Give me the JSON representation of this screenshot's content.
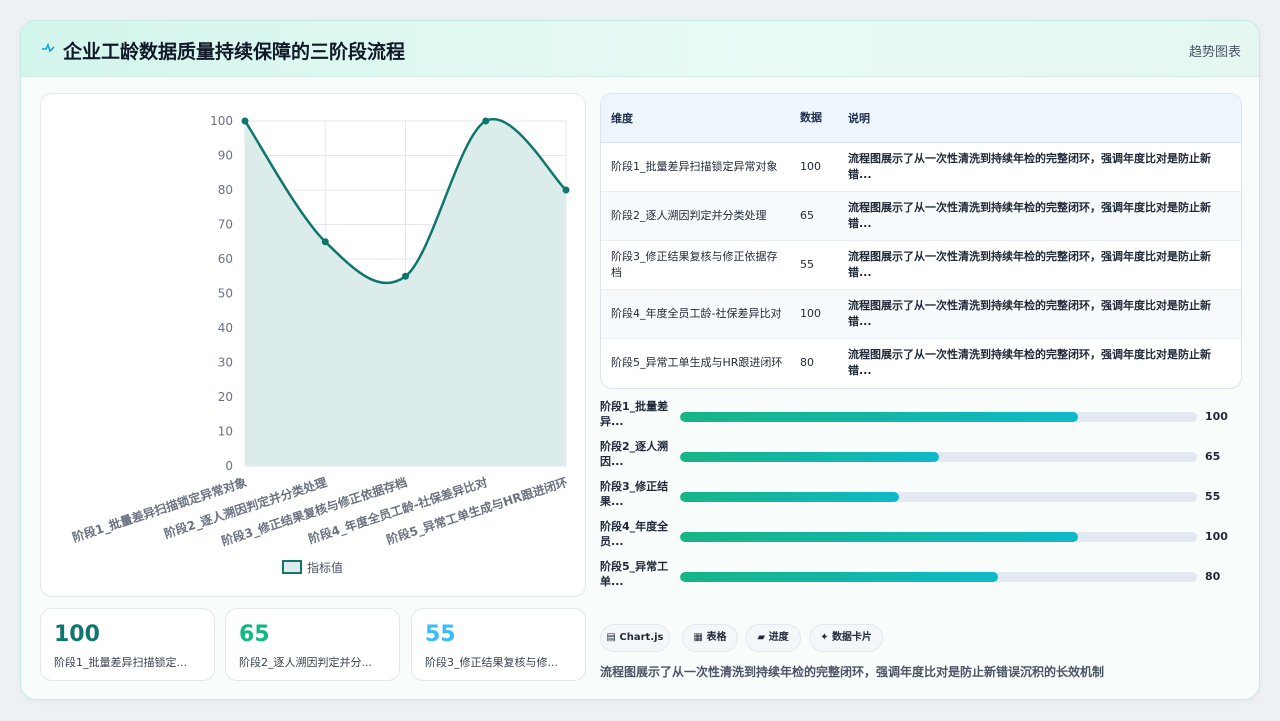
{
  "header": {
    "title": "企业工龄数据质量持续保障的三阶段流程",
    "title_icon": "pulse-icon",
    "link_label": "趋势图表"
  },
  "chart_data": {
    "type": "line",
    "categories": [
      "阶段1_批量差异扫描锁定异常对象",
      "阶段2_逐人溯因判定并分类处理",
      "阶段3_修正结果复核与修正依据存档",
      "阶段4_年度全员工龄-社保差异比对",
      "阶段5_异常工单生成与HR跟进闭环"
    ],
    "series": [
      {
        "name": "指标值",
        "values": [
          100,
          65,
          55,
          100,
          80
        ]
      }
    ],
    "ylim": [
      0,
      100
    ],
    "yticks": [
      0,
      10,
      20,
      30,
      40,
      50,
      60,
      70,
      80,
      90,
      100
    ],
    "fill": true,
    "grid": true,
    "legend_position": "bottom",
    "colors": {
      "line": "#0f766e",
      "fill": "#dcecea",
      "grid": "#e5e7eb"
    }
  },
  "stats": [
    {
      "value": "100",
      "label": "阶段1_批量差异扫描锁定...",
      "color": "#0f766e"
    },
    {
      "value": "65",
      "label": "阶段2_逐人溯因判定并分...",
      "color": "#10b981"
    },
    {
      "value": "55",
      "label": "阶段3_修正结果复核与修...",
      "color": "#38bdf8"
    }
  ],
  "table": {
    "headers": [
      "维度",
      "数据",
      "说明"
    ],
    "rows": [
      {
        "dim": "阶段1_批量差异扫描锁定异常对象",
        "value": "100",
        "desc": "流程图展示了从一次性清洗到持续年检的完整闭环，强调年度比对是防止新错..."
      },
      {
        "dim": "阶段2_逐人溯因判定并分类处理",
        "value": "65",
        "desc": "流程图展示了从一次性清洗到持续年检的完整闭环，强调年度比对是防止新错..."
      },
      {
        "dim": "阶段3_修正结果复核与修正依据存档",
        "value": "55",
        "desc": "流程图展示了从一次性清洗到持续年检的完整闭环，强调年度比对是防止新错..."
      },
      {
        "dim": "阶段4_年度全员工龄-社保差异比对",
        "value": "100",
        "desc": "流程图展示了从一次性清洗到持续年检的完整闭环，强调年度比对是防止新错..."
      },
      {
        "dim": "阶段5_异常工单生成与HR跟进闭环",
        "value": "80",
        "desc": "流程图展示了从一次性清洗到持续年检的完整闭环，强调年度比对是防止新错..."
      }
    ]
  },
  "progress": [
    {
      "label": "阶段1_批量差异...",
      "value": "100",
      "fraction": 0.77
    },
    {
      "label": "阶段2_逐人溯因...",
      "value": "65",
      "fraction": 0.5
    },
    {
      "label": "阶段3_修正结果...",
      "value": "55",
      "fraction": 0.423
    },
    {
      "label": "阶段4_年度全员...",
      "value": "100",
      "fraction": 0.77
    },
    {
      "label": "阶段5_异常工单...",
      "value": "80",
      "fraction": 0.615
    }
  ],
  "chips": [
    {
      "icon": "chart-icon",
      "label": "Chart.js",
      "glyph": "▤"
    },
    {
      "icon": "table-icon",
      "label": "表格",
      "glyph": "▦"
    },
    {
      "icon": "progress-icon",
      "label": "进度",
      "glyph": "▰"
    },
    {
      "icon": "card-icon",
      "label": "数据卡片",
      "glyph": "✦"
    }
  ],
  "footer": {
    "text": "流程图展示了从一次性清洗到持续年检的完整闭环，强调年度比对是防止新错误沉积的长效机制"
  }
}
